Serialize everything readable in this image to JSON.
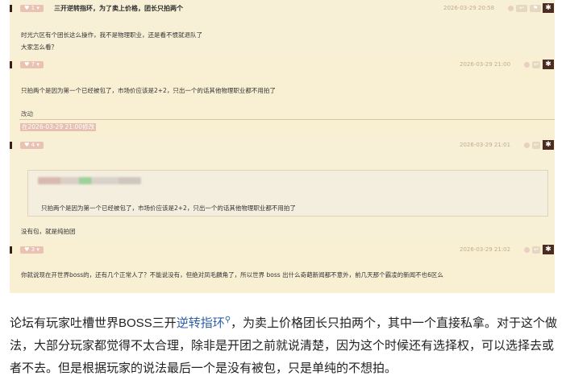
{
  "posts": [
    {
      "likes": "1",
      "title": "三开逆转指环，为了卖上价格，团长只拍两个",
      "time": "2026-03-29 20:58",
      "lines": [
        "时光六区有个团长这么操作，我不是物理职业，还是看不惯就退队了",
        "大家怎么看？"
      ]
    },
    {
      "likes": "7",
      "time": "2026-03-29 21:00",
      "lines": [
        "只拍两个是因为第一个已经被包了，市场价应该是2+2，只出一个的话其他物理职业都不用拍了"
      ],
      "edit_label": "改动",
      "edit_note": "在2026-03-29 21:00修改"
    },
    {
      "likes": "4",
      "time": "2026-03-29 21:01",
      "quote": "只拍两个是因为第一个已经被包了，市场价应该是2+2，只出一个的话其他物理职业都不用拍了",
      "reply": "没有包，就是纯拍团"
    },
    {
      "likes": "3",
      "time": "2026-03-29 21:02",
      "lines": [
        "你就说现在开世界boss的，还有几个正常人了？不能说没有，但绝对凤毛麟角了，所以世界 boss 出什么奇葩新闻都不意外，前几天那个霸凌的新闻不也6区么"
      ]
    }
  ],
  "icons": {
    "gear": "gear-icon",
    "like": "thumb-up-icon",
    "search": "search-icon"
  },
  "article": {
    "before_link": "论坛有玩家吐槽世界BOSS三开",
    "link_text": "逆转指环",
    "after_link": "，为卖上价格团长只拍两个，其中一个直接私拿。对于这个做法，大部分玩家都觉得不太合理，除非是开团之前就说清楚，因为这个时候还有选择权，可以选择去或者不去。但是根据玩家的说法最后一个是没有被包，只是单纯的不想拍。"
  },
  "colors": {
    "panel_bg": "#f7efd6",
    "accent_dark": "#4a2c22",
    "link": "#2d5ea8"
  }
}
